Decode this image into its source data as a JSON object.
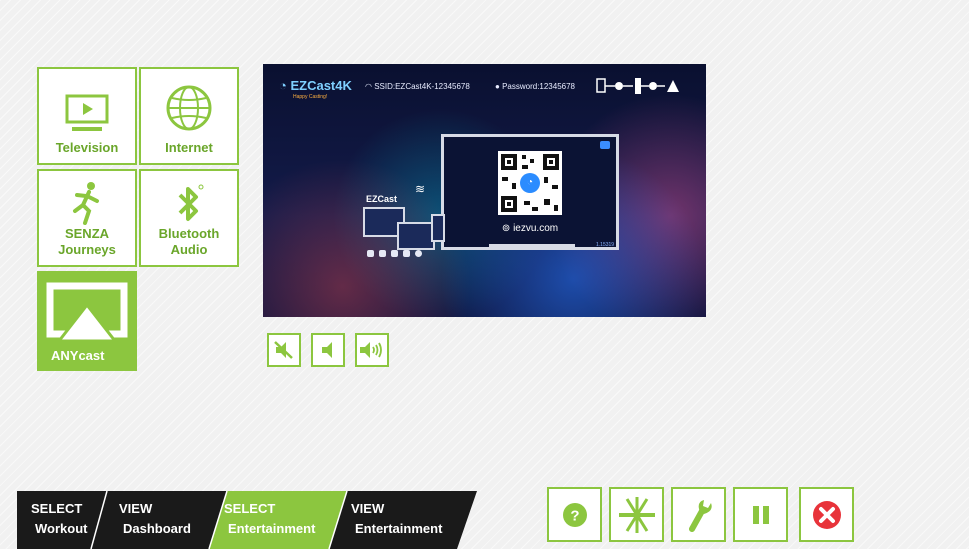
{
  "tiles": {
    "television": "Television",
    "internet": "Internet",
    "senza_line1": "SENZA",
    "senza_line2": "Journeys",
    "bluetooth_line1": "Bluetooth",
    "bluetooth_line2": "Audio",
    "anycast": "ANYcast"
  },
  "screen": {
    "brand": "EZCast4K",
    "tagline": "Happy Casting!",
    "ssid": "SSID:EZCast4K-12345678",
    "password": "Password:12345678",
    "url": "iezvu.com",
    "ezcast_label": "EZCast",
    "version": "1.15319"
  },
  "bottom_nav": [
    {
      "line1": "SELECT",
      "line2": "Workout",
      "active": false
    },
    {
      "line1": "VIEW",
      "line2": "Dashboard",
      "active": false
    },
    {
      "line1": "SELECT",
      "line2": "Entertainment",
      "active": true
    },
    {
      "line1": "VIEW",
      "line2": "Entertainment",
      "active": false
    }
  ],
  "colors": {
    "accent": "#8cc63f",
    "nav_dark": "#1a1a1a",
    "close_red": "#e8333a"
  },
  "icons": {
    "volume": [
      "volume-mute-icon",
      "volume-low-icon",
      "volume-high-icon"
    ],
    "actions": [
      "help-icon",
      "stretch-icon",
      "wrench-icon",
      "pause-icon",
      "close-icon"
    ]
  }
}
